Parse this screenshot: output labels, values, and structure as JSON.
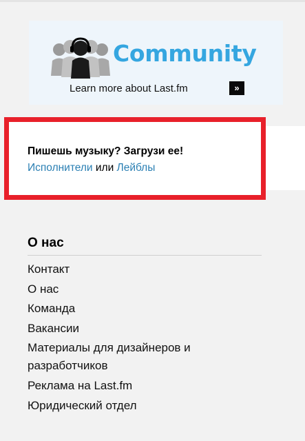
{
  "community_banner": {
    "title": "Community",
    "learn_more": "Learn more about Last.fm",
    "arrow_glyph": "»",
    "title_color": "#35a6e0",
    "icons": [
      "people-icon",
      "go-arrow-icon"
    ]
  },
  "upload_box": {
    "heading": "Пишешь музыку? Загрузи ее!",
    "link_artists": "Исполнители",
    "conjunction": " или ",
    "link_labels": "Лейблы",
    "border_color": "#e8202a",
    "link_color": "#2a7fb3"
  },
  "about": {
    "title": "О нас",
    "items": [
      "Контакт",
      "О нас",
      "Команда",
      "Вакансии",
      "Материалы для дизайнеров и разработчиков",
      "Реклама на Last.fm",
      "Юридический отдел"
    ]
  }
}
